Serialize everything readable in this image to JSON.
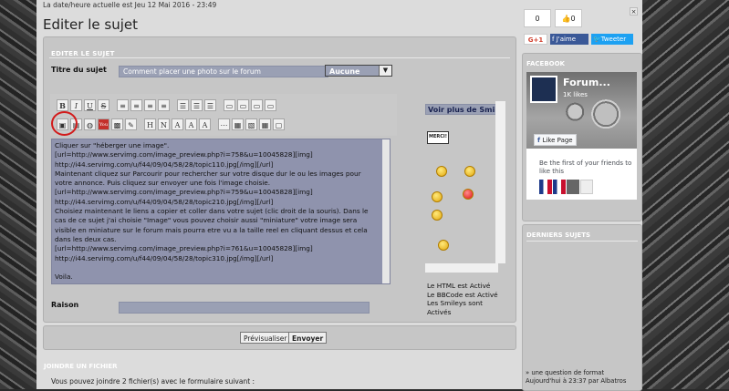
{
  "header": {
    "datetime": "La date/heure actuelle est Jeu 12 Mai 2016 - 23:49",
    "title": "Editer le sujet"
  },
  "form": {
    "section_title": "EDITER LE SUJET",
    "subject_label": "Titre du sujet",
    "subject_value": "Comment placer une photo sur le forum",
    "select_value": "Aucune",
    "reason_label": "Raison",
    "reason_value": ""
  },
  "toolbar": {
    "row1": [
      "B",
      "I",
      "U",
      "S",
      "≡",
      "≡",
      "≡",
      "≡",
      "☰",
      "☰",
      "☰",
      "▭",
      "▭",
      "▭",
      "▭"
    ],
    "row2": [
      "▣",
      "▤",
      "◍",
      "You",
      "▩",
      "✎",
      "H",
      "N",
      "A",
      "A",
      "A",
      "⋯",
      "▦",
      "▧",
      "▦",
      "▢"
    ]
  },
  "editor": {
    "lines": [
      "Cliquer sur \"héberger une image\".",
      "[url=http://www.servimg.com/image_preview.php?i=758&u=10045828][img]",
      "http://i44.servimg.com/u/f44/09/04/58/28/topic110.jpg[/img][/url]",
      "Maintenant cliquez sur Parcourir pour rechercher sur votre disque dur le ou les images pour",
      "votre annonce. Puis cliquez sur envoyer une fois l'image choisie.",
      "[url=http://www.servimg.com/image_preview.php?i=759&u=10045828][img]",
      "http://i44.servimg.com/u/f44/09/04/58/28/topic210.jpg[/img][/url]",
      "Choisiez maintenant le liens a copier et coller dans votre sujet (clic droit de la souris). Dans le",
      "cas de ce sujet j'ai choisie \"Image\" vous pouvez choisir aussi \"miniature\" votre image sera",
      "visible en miniature sur le forum mais pourra etre vu a la taille reel en cliquant dessus et cela",
      "dans les deux cas.",
      "[url=http://www.servimg.com/image_preview.php?i=761&u=10045828][img]",
      "http://i44.servimg.com/u/f44/09/04/58/28/topic310.jpg[/img][/url]",
      "",
      "Voila."
    ]
  },
  "smilies": {
    "more_label": "Voir plus de Smilies",
    "merci": "MERCI!"
  },
  "status": {
    "html": "Le HTML est Activé",
    "bbcode": "Le BBCode est Activé",
    "smileys_1": "Les Smileys sont",
    "smileys_2": "Activés"
  },
  "actions": {
    "preview": "Prévisualiser",
    "send": "Envoyer"
  },
  "attach": {
    "title": "JOINDRE UN FICHIER",
    "text": "Vous pouvez joindre 2 fichier(s) avec le formulaire suivant :"
  },
  "sidebar": {
    "share_count": "0",
    "like_count": "0",
    "gplus": "G+1",
    "fb_like": "J'aime",
    "tweet": "Tweeter",
    "facebook_title": "FACEBOOK",
    "fb_page_name": "Forum...",
    "fb_likes": "1K likes",
    "like_page": "Like Page",
    "fb_first": "Be the first of your friends to like this",
    "recent_title": "DERNIERS SUJETS",
    "recent_line1": "» une question de format",
    "recent_line2": "Aujourd'hui à 23:37 par Albatros"
  },
  "colors": {
    "accent_blue": "#9aa0b4",
    "facebook": "#3b5998",
    "twitter": "#1da1f2",
    "highlight_circle": "#d21c1c"
  }
}
